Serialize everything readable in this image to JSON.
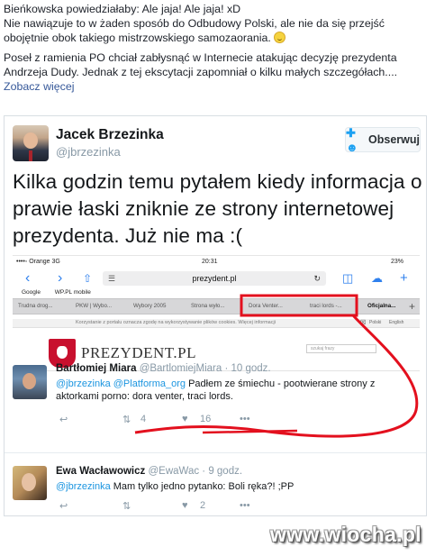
{
  "post": {
    "line1": "Bieńkowska powiedziałaby: Ale jaja! Ale jaja! xD",
    "line2": "Nie nawiązuje to w żaden sposób do Odbudowy Polski, ale nie da się przejść obojętnie obok takiego mistrzowskiego samozaorania.",
    "para2": "Poseł z ramienia PO chciał zabłysnąć w Internecie atakując decyzję prezydenta Andrzeja Dudy. Jednak z tej ekscytacji zapomniał o kilku małych szczegółach....",
    "more_link": "Zobacz więcej"
  },
  "tweet": {
    "author_name": "Jacek Brzezinka",
    "author_handle": "@jbrzezinka",
    "follow_label": "Obserwuj",
    "text": "Kilka godzin temu pytałem kiedy informacja o prawie łaski zniknie ze strony internetowej prezydenta. Już nie ma :("
  },
  "screenshot": {
    "carrier": "••••◦ Orange  3G",
    "time": "20:31",
    "battery": "23%",
    "url": "prezydent.pl",
    "bookmarks": [
      "Google",
      "WP.PL mobile"
    ],
    "tabs": [
      "Trudna drog...",
      "PKW | Wybo...",
      "Wybory 2005",
      "Strona wyło...",
      "Dora Venter...",
      "traci lords -...",
      "Oficjalna..."
    ],
    "ticker_text": "Korzystanie z portalu oznacza zgodę na wykorzystywanie plików cookies. Więcej informacji",
    "lang_labels": [
      "Polski",
      "English"
    ],
    "site_name": "PREZYDENT.PL",
    "search_placeholder": "szukaj frazy"
  },
  "replies": [
    {
      "name": "Bartłomiej Miara",
      "handle": "@BartlomiejMiara · 10 godz.",
      "mention1": "@jbrzezinka",
      "mention2": "@Platforma_org",
      "text_a": " Padłem ze śmiechu - pootwierane strony z aktorkami porno: ",
      "text_b": "dora venter, traci lords.",
      "retweets": "4",
      "likes": "16"
    },
    {
      "name": "Ewa Wacławowicz",
      "handle": "@EwaWac · 9 godz.",
      "mention1": "@jbrzezinka",
      "text_a": " Mam tylko jedno pytanko: Boli ręka?! ;PP",
      "retweets": "",
      "likes": "2"
    }
  ],
  "watermark": "www.wiocha.pl",
  "colors": {
    "link": "#1b95e0",
    "annotation": "#e3101e",
    "facebook_link": "#365899"
  }
}
